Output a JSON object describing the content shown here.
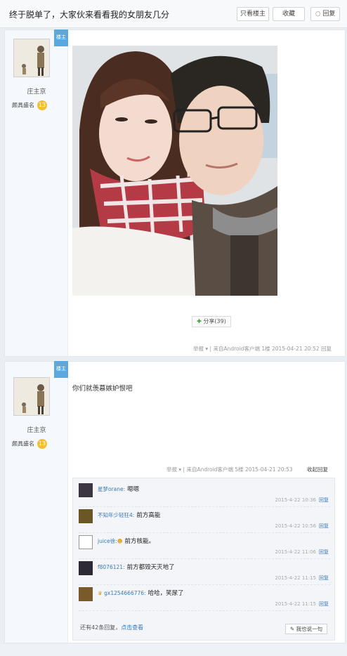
{
  "header": {
    "title": "终于脱单了，大家伙来看看我的女朋友几分",
    "buttons": [
      "只看楼主",
      "收藏",
      "回复"
    ]
  },
  "post1": {
    "author": "庄主京",
    "level_label": "颇具盛名",
    "level_num": "13",
    "badge": "楼主",
    "share_label": "分享(39)",
    "meta": "举报 ▾ | 来自Android客户端 1楼 2015-04-21 20:52 回复"
  },
  "post2": {
    "author": "庄主京",
    "level_label": "颇具盛名",
    "level_num": "13",
    "badge": "楼主",
    "text": "你们就羡慕嫉妒恨吧",
    "meta": "举报 ▾ | 来自Android客户端 5楼 2015-04-21 20:53",
    "collapse_label": "收起回复",
    "comments": [
      {
        "name": "星梦orane:",
        "text": "嗯嗯",
        "time": "2015-4-22 10:36",
        "reply": "回复"
      },
      {
        "name": "不知年少轻狂4:",
        "text": "前方高能",
        "time": "2015-4-22 10:56",
        "reply": "回复"
      },
      {
        "name": "juice徐:",
        "text": "前方核能。",
        "time": "2015-4-22 11:06",
        "reply": "回复"
      },
      {
        "name": "f8076121:",
        "text": "前方都毁天灭地了",
        "time": "2015-4-22 11:15",
        "reply": "回复"
      },
      {
        "name": "gx1254666776:",
        "text": "哈哈，笑尿了",
        "time": "2015-4-22 11:15",
        "reply": "回复"
      }
    ],
    "more_prefix": "还有",
    "more_count": "42",
    "more_mid": "条回复，",
    "more_link": "点击查看",
    "say_label": "我也说一句"
  },
  "colors": {
    "accent": "#3a79b4",
    "badge": "#5aa9de",
    "level": "#f1c02a"
  }
}
